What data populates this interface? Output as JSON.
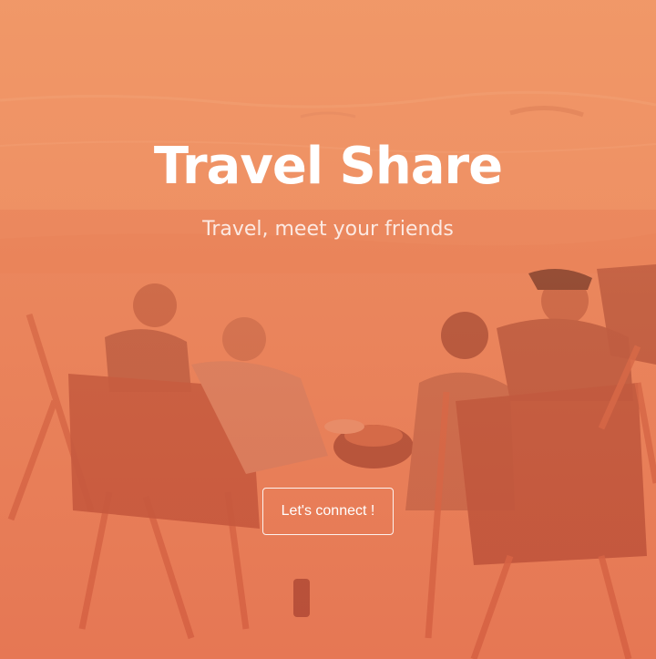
{
  "hero": {
    "title": "Travel Share",
    "subtitle": "Travel, meet your friends",
    "cta_label": "Let's connect !",
    "background_image": "beach-campfire-photo",
    "overlay_color": "#ec8058"
  }
}
